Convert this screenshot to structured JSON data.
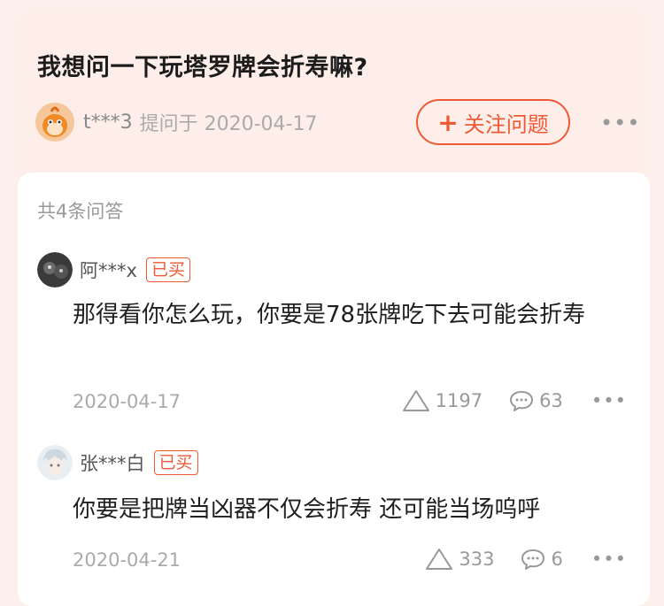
{
  "question": {
    "title": "我想问一下玩塔罗牌会折寿嘛?",
    "user": "t***3",
    "date_text": "提问于 2020-04-17",
    "follow_label": "关注问题",
    "more": "•••"
  },
  "answers_header": "共4条问答",
  "answers": [
    {
      "user": "阿***x",
      "badge": "已买",
      "text": "那得看你怎么玩，你要是78张牌吃下去可能会折寿",
      "date": "2020-04-17",
      "likes": "1197",
      "comments": "63",
      "more": "•••"
    },
    {
      "user": "张***白",
      "badge": "已买",
      "text": "你要是把牌当凶器不仅会折寿 还可能当场呜呼",
      "date": "2020-04-21",
      "likes": "333",
      "comments": "6",
      "more": "•••"
    }
  ],
  "colors": {
    "accent": "#ee5a35",
    "page_bg": "#fdf0ec",
    "card_bg": "#ffffff"
  }
}
